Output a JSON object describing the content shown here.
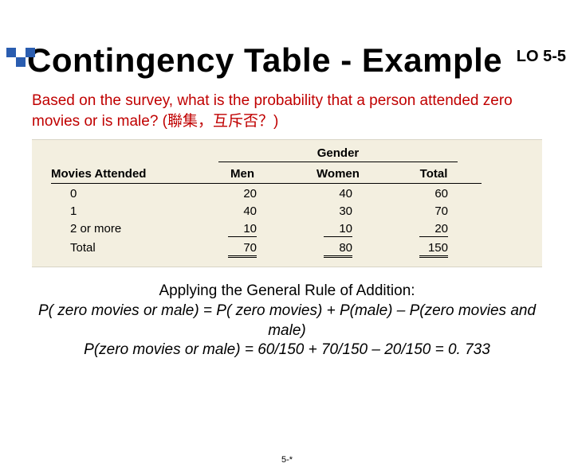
{
  "header": {
    "lo": "LO 5-5",
    "title": "Contingency Table - Example"
  },
  "prompt": "Based on the survey, what is the probability that a person attended zero movies or is male? (聯集，互斥否？)",
  "table": {
    "group_header": "Gender",
    "row_header": "Movies Attended",
    "col1": "Men",
    "col2": "Women",
    "col3": "Total",
    "rows": [
      {
        "label": "0",
        "c1": "20",
        "c2": "40",
        "c3": "60"
      },
      {
        "label": "1",
        "c1": "40",
        "c2": "30",
        "c3": "70"
      },
      {
        "label": "2 or more",
        "c1": "10",
        "c2": "10",
        "c3": "20"
      }
    ],
    "total": {
      "label": "Total",
      "c1": "70",
      "c2": "80",
      "c3": "150"
    }
  },
  "explain": {
    "l1": "Applying the General Rule of Addition:",
    "l2": "P( zero movies or male) = P( zero movies) + P(male) – P(zero movies and male)",
    "l3": "P(zero movies or male) = 60/150 + 70/150 – 20/150 = 0. 733"
  },
  "footer": "5-*",
  "chart_data": {
    "type": "table",
    "title": "Movies Attended by Gender",
    "columns": [
      "Movies Attended",
      "Men",
      "Women",
      "Total"
    ],
    "rows": [
      [
        "0",
        20,
        40,
        60
      ],
      [
        "1",
        40,
        30,
        70
      ],
      [
        "2 or more",
        10,
        10,
        20
      ],
      [
        "Total",
        70,
        80,
        150
      ]
    ]
  }
}
